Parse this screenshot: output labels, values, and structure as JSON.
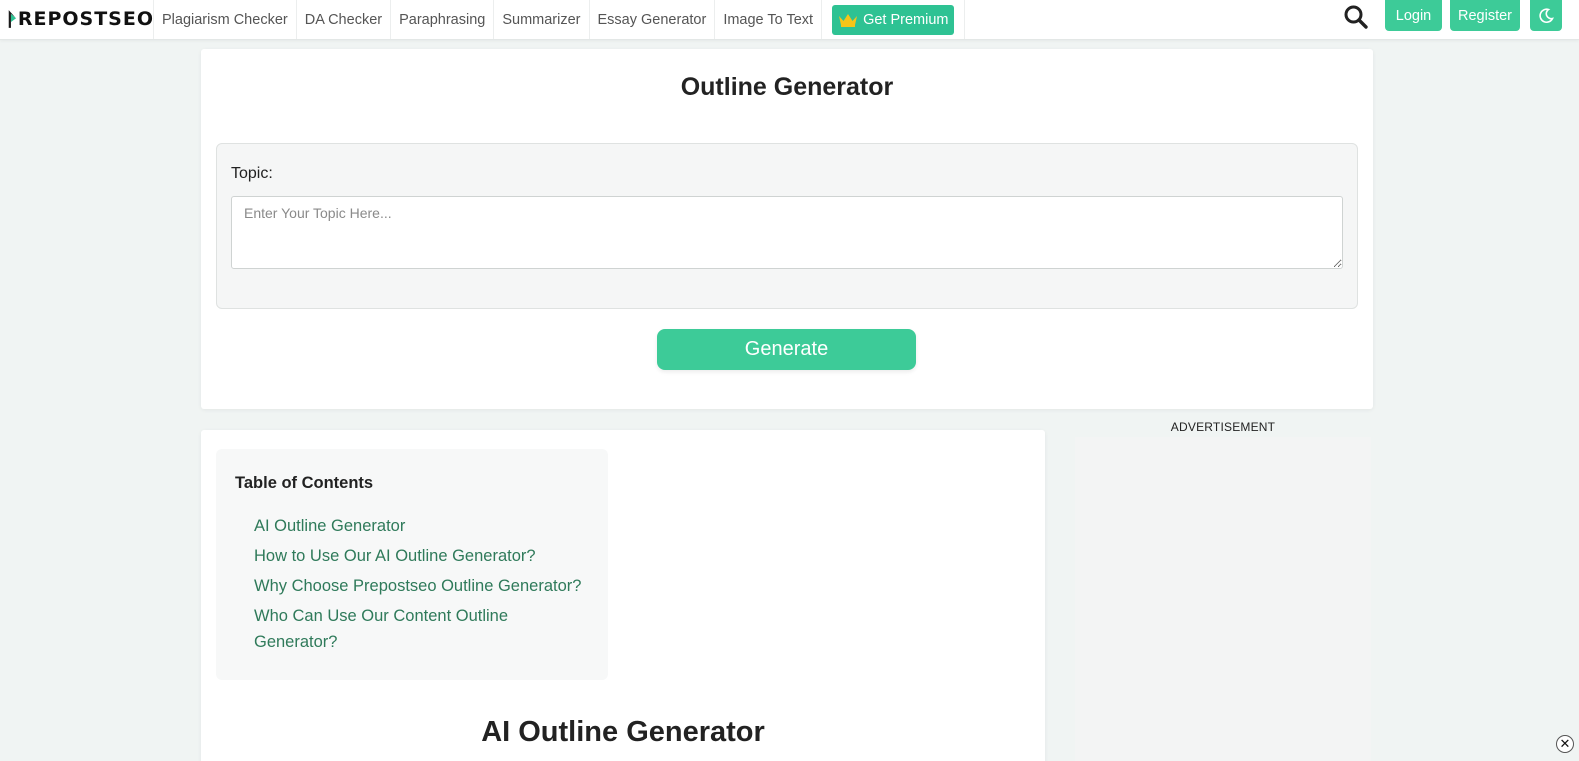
{
  "brand": {
    "name": "REPOSTSEO",
    "accent": "#3dcb98",
    "link_color": "#2f7a5a"
  },
  "nav": {
    "items": [
      {
        "label": "Plagiarism Checker"
      },
      {
        "label": "DA Checker"
      },
      {
        "label": "Paraphrasing"
      },
      {
        "label": "Summarizer"
      },
      {
        "label": "Essay Generator"
      },
      {
        "label": "Image To Text"
      }
    ],
    "premium_label": "Get Premium",
    "premium_icon": "crown-icon",
    "search_icon": "search-icon",
    "login_label": "Login",
    "register_label": "Register",
    "darkmode_icon": "moon-icon"
  },
  "tool": {
    "title": "Outline Generator",
    "topic_label": "Topic:",
    "topic_placeholder": "Enter Your Topic Here...",
    "topic_value": "",
    "generate_label": "Generate"
  },
  "toc": {
    "title": "Table of Contents",
    "items": [
      "AI Outline Generator",
      "How to Use Our AI Outline Generator?",
      "Why Choose Prepostseo Outline Generator?",
      "Who Can Use Our Content Outline Generator?"
    ]
  },
  "content": {
    "section_title": "AI Outline Generator"
  },
  "ad": {
    "label": "ADVERTISEMENT",
    "close_glyph": "✕"
  }
}
